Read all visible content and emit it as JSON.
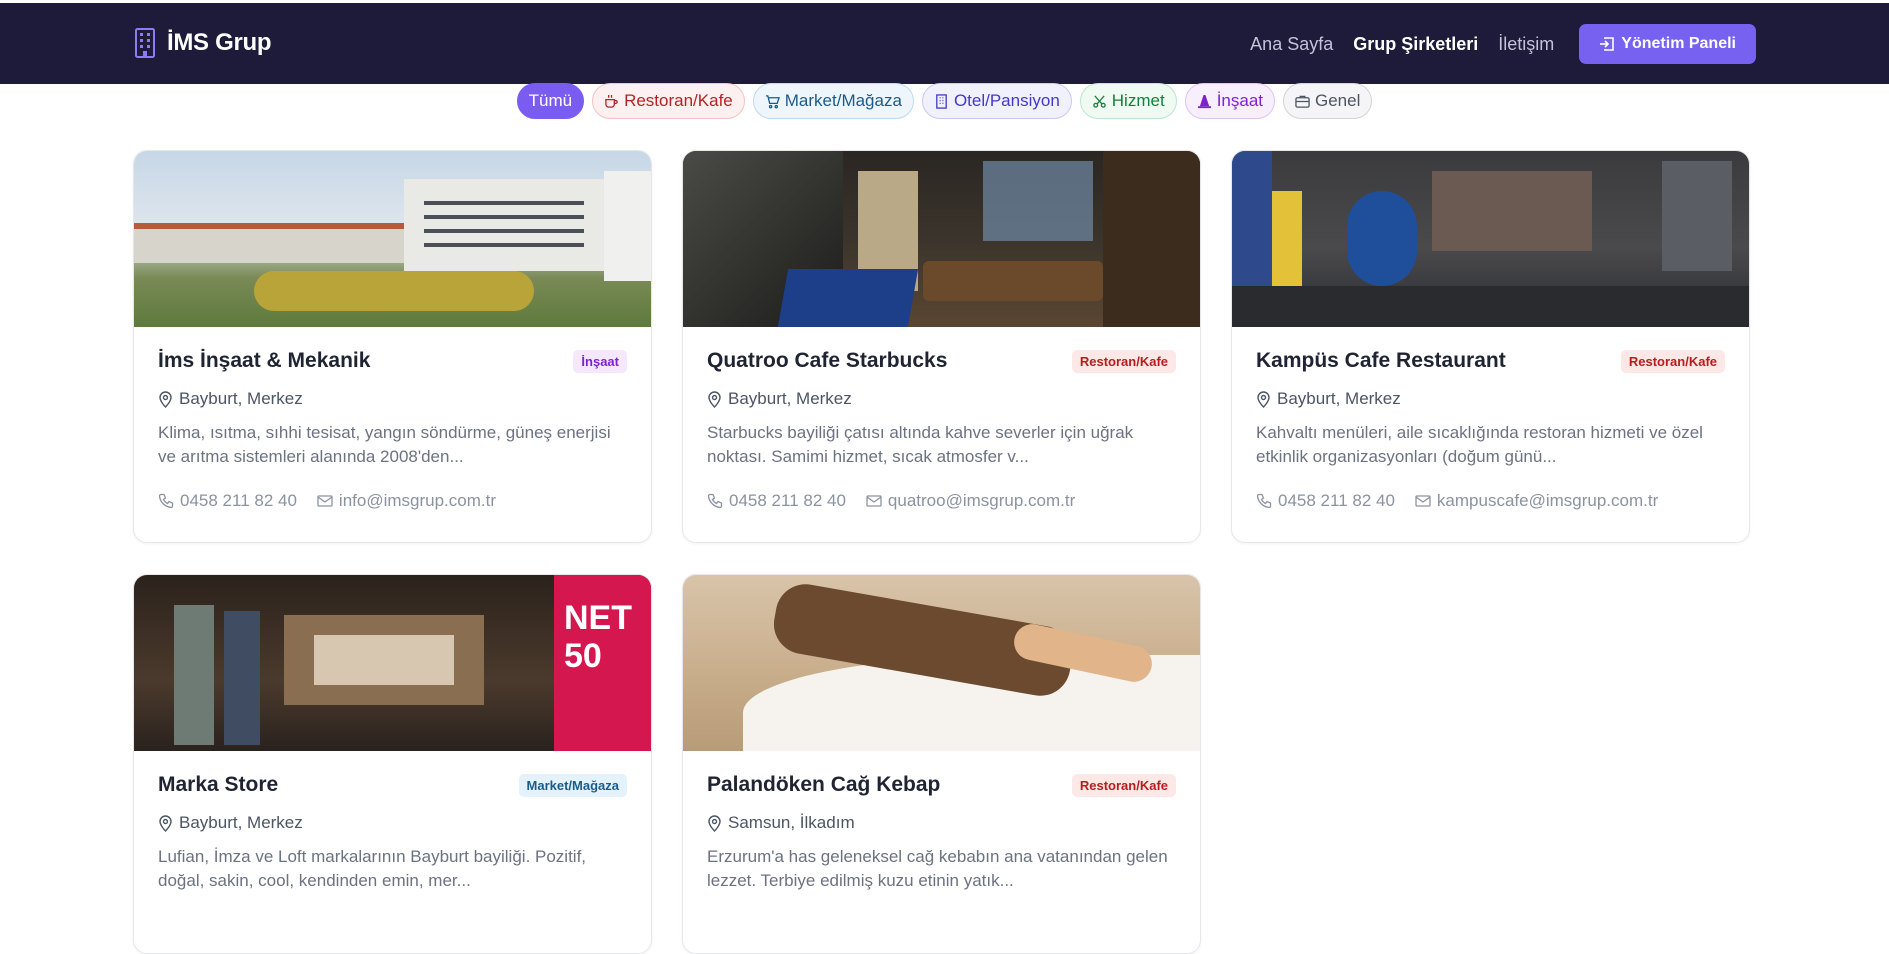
{
  "brand": {
    "name": "İMS Grup",
    "icon": "building-icon"
  },
  "nav": {
    "home": "Ana Sayfa",
    "companies": "Grup Şirketleri",
    "contact": "İletişim",
    "panel": "Yönetim Paneli"
  },
  "filters": [
    {
      "label": "Tümü",
      "icon": ""
    },
    {
      "label": "Restoran/Kafe",
      "icon": "cup-icon"
    },
    {
      "label": "Market/Mağaza",
      "icon": "cart-icon"
    },
    {
      "label": "Otel/Pansiyon",
      "icon": "building-icon"
    },
    {
      "label": "Hizmet",
      "icon": "scissors-icon"
    },
    {
      "label": "İnşaat",
      "icon": "cone-icon"
    },
    {
      "label": "Genel",
      "icon": "briefcase-icon"
    }
  ],
  "cards": [
    {
      "title": "İms İnşaat & Mekanik",
      "badge": "İnşaat",
      "location": "Bayburt, Merkez",
      "description": "Klima, ısıtma, sıhhi tesisat, yangın söndürme, güneş enerjisi ve arıtma sistemleri alanında 2008'den...",
      "phone": "0458 211 82 40",
      "email": "info@imsgrup.com.tr"
    },
    {
      "title": "Quatroo Cafe Starbucks",
      "badge": "Restoran/Kafe",
      "location": "Bayburt, Merkez",
      "description": "Starbucks bayiliği çatısı altında kahve severler için uğrak noktası. Samimi hizmet, sıcak atmosfer v...",
      "phone": "0458 211 82 40",
      "email": "quatroo@imsgrup.com.tr"
    },
    {
      "title": "Kampüs Cafe Restaurant",
      "badge": "Restoran/Kafe",
      "location": "Bayburt, Merkez",
      "description": "Kahvaltı menüleri, aile sıcaklığında restoran hizmeti ve özel etkinlik organizasyonları (doğum günü...",
      "phone": "0458 211 82 40",
      "email": "kampuscafe@imsgrup.com.tr"
    },
    {
      "title": "Marka Store",
      "badge": "Market/Mağaza",
      "location": "Bayburt, Merkez",
      "description": "Lufian, İmza ve Loft markalarının Bayburt bayiliği. Pozitif, doğal, sakin, cool, kendinden emin, mer...",
      "phone": "",
      "email": ""
    },
    {
      "title": "Palandöken Cağ Kebap",
      "badge": "Restoran/Kafe",
      "location": "Samsun, İlkadım",
      "description": "Erzurum'a has geleneksel cağ kebabın ana vatanından gelen lezzet. Terbiye edilmiş kuzu etinin yatık...",
      "phone": "",
      "email": ""
    }
  ]
}
